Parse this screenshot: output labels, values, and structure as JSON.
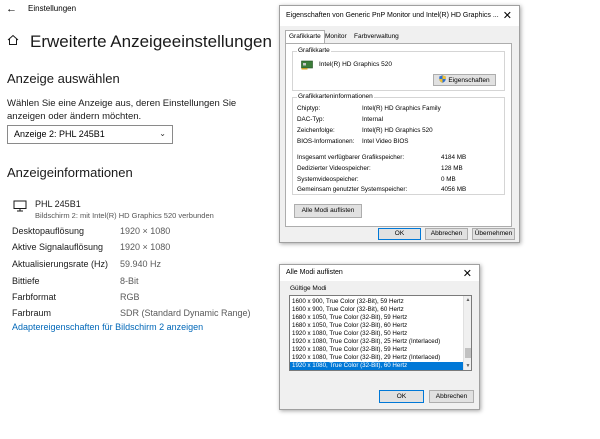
{
  "settings": {
    "window_title": "Einstellungen",
    "page_title": "Erweiterte Anzeigeeinstellungen",
    "select_section": "Anzeige auswählen",
    "description": "Wählen Sie eine Anzeige aus, deren Einstellungen Sie anzeigen oder ändern möchten.",
    "display_dropdown": "Anzeige 2: PHL 245B1",
    "info_section": "Anzeigeinformationen",
    "monitor_name": "PHL 245B1",
    "monitor_subtitle": "Bildschirm 2: mit Intel(R) HD Graphics 520 verbunden",
    "info_rows": [
      {
        "label": "Desktopauflösung",
        "value": "1920 × 1080"
      },
      {
        "label": "Aktive Signalauflösung",
        "value": "1920 × 1080"
      },
      {
        "label": "Aktualisierungsrate (Hz)",
        "value": "59.940 Hz"
      },
      {
        "label": "Bittiefe",
        "value": "8-Bit"
      },
      {
        "label": "Farbformat",
        "value": "RGB"
      },
      {
        "label": "Farbraum",
        "value": "SDR (Standard Dynamic Range)"
      }
    ],
    "adapter_link": "Adaptereigenschaften für Bildschirm 2 anzeigen",
    "link_color": "#0067b8"
  },
  "properties_dialog": {
    "title": "Eigenschaften von Generic PnP Monitor und Intel(R) HD Graphics ...",
    "close": "✕",
    "tabs": [
      "Grafikkarte",
      "Monitor",
      "Farbverwaltung"
    ],
    "adapter_group": "Grafikkarte",
    "adapter_name": "Intel(R) HD Graphics 520",
    "properties_button": "Eigenschaften",
    "info_group": "Grafikkarteninformationen",
    "info": [
      {
        "label": "Chiptyp:",
        "value": "Intel(R) HD Graphics Family"
      },
      {
        "label": "DAC-Typ:",
        "value": "Internal"
      },
      {
        "label": "Zeichenfolge:",
        "value": "Intel(R) HD Graphics 520"
      },
      {
        "label": "BIOS-Informationen:",
        "value": "Intel Video BIOS"
      }
    ],
    "memory": [
      {
        "label": "Insgesamt verfügbarer Grafikspeicher:",
        "value": "4184 MB"
      },
      {
        "label": "Dedizierter Videospeicher:",
        "value": "128 MB"
      },
      {
        "label": "Systemvideospeicher:",
        "value": "0 MB"
      },
      {
        "label": "Gemeinsam genutzter Systemspeicher:",
        "value": "4056 MB"
      }
    ],
    "list_modes_button": "Alle Modi auflisten",
    "ok": "OK",
    "cancel": "Abbrechen",
    "apply": "Übernehmen"
  },
  "modes_dialog": {
    "title": "Alle Modi auflisten",
    "close": "✕",
    "label": "Gültige Modi",
    "modes": [
      "1600 x 900, True Color (32-Bit), 59 Hertz",
      "1600 x 900, True Color (32-Bit), 60 Hertz",
      "1680 x 1050, True Color (32-Bit), 59 Hertz",
      "1680 x 1050, True Color (32-Bit), 60 Hertz",
      "1920 x 1080, True Color (32-Bit), 50 Hertz",
      "1920 x 1080, True Color (32-Bit), 25 Hertz (Interlaced)",
      "1920 x 1080, True Color (32-Bit), 59 Hertz",
      "1920 x 1080, True Color (32-Bit), 29 Hertz (Interlaced)",
      "1920 x 1080, True Color (32-Bit), 60 Hertz"
    ],
    "selected_mode": "1920 x 1080, True Color (32-Bit), 60 Hertz",
    "selection_color": "#0078d7",
    "ok": "OK",
    "cancel": "Abbrechen"
  }
}
